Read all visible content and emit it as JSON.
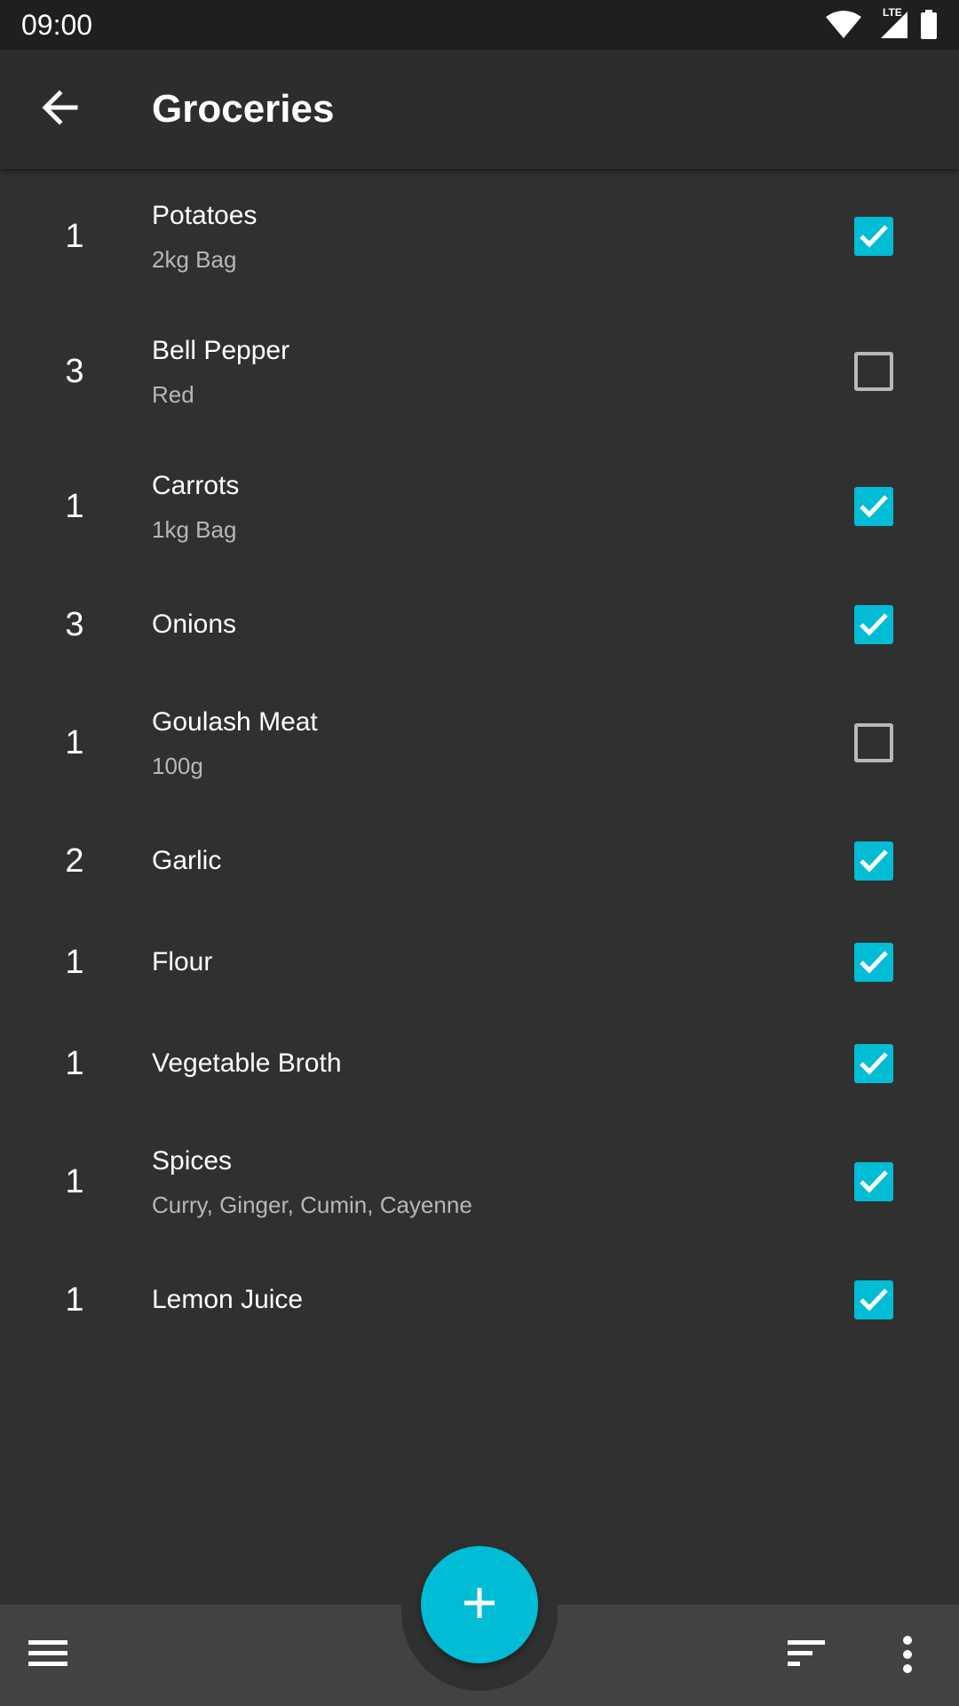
{
  "status_bar": {
    "time": "09:00",
    "network": "LTE",
    "icons": [
      "wifi-icon",
      "lte-signal-icon",
      "battery-icon"
    ]
  },
  "app_bar": {
    "title": "Groceries",
    "back_icon": "arrow-left-icon"
  },
  "items": [
    {
      "qty": "1",
      "name": "Potatoes",
      "note": "2kg Bag",
      "checked": true
    },
    {
      "qty": "3",
      "name": "Bell Pepper",
      "note": "Red",
      "checked": false
    },
    {
      "qty": "1",
      "name": "Carrots",
      "note": "1kg Bag",
      "checked": true
    },
    {
      "qty": "3",
      "name": "Onions",
      "note": "",
      "checked": true
    },
    {
      "qty": "1",
      "name": "Goulash Meat",
      "note": "100g",
      "checked": false
    },
    {
      "qty": "2",
      "name": "Garlic",
      "note": "",
      "checked": true
    },
    {
      "qty": "1",
      "name": "Flour",
      "note": "",
      "checked": true
    },
    {
      "qty": "1",
      "name": "Vegetable Broth",
      "note": "",
      "checked": true
    },
    {
      "qty": "1",
      "name": "Spices",
      "note": "Curry, Ginger, Cumin, Cayenne",
      "checked": true
    },
    {
      "qty": "1",
      "name": "Lemon Juice",
      "note": "",
      "checked": true
    }
  ],
  "bottom_bar": {
    "menu_icon": "hamburger-menu-icon",
    "fab_icon": "plus-icon",
    "sort_icon": "sort-icon",
    "more_icon": "more-vertical-icon"
  },
  "colors": {
    "accent": "#00bcd4",
    "background": "#303030",
    "app_bar": "#2d2d2d",
    "bottom_bar": "#424242",
    "status_bar": "#1f1f1f"
  }
}
